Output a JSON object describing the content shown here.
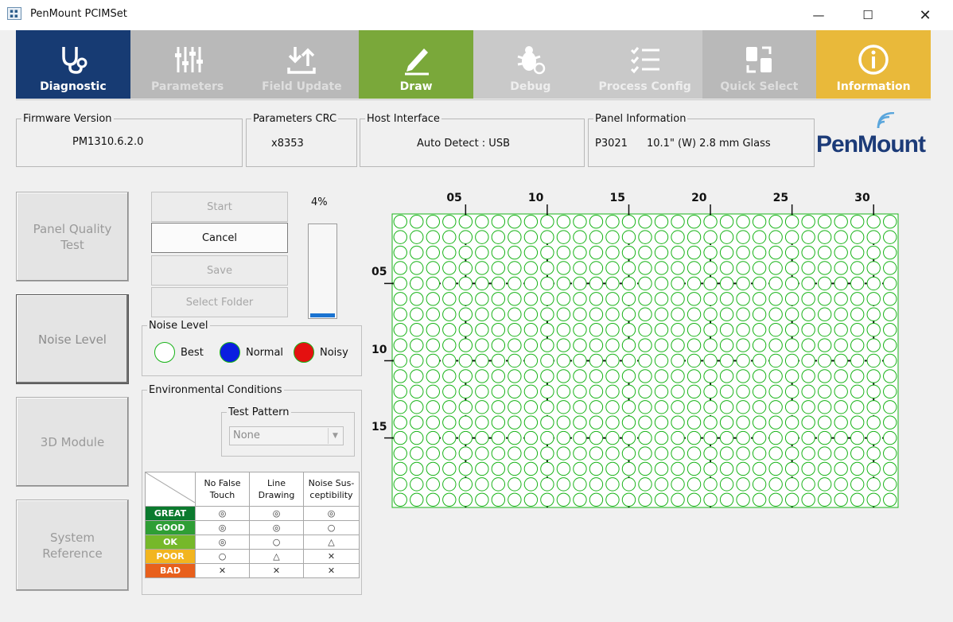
{
  "window": {
    "title": "PenMount PCIMSet",
    "minimize": "—",
    "maximize": "☐",
    "close": "✕"
  },
  "toolbar": [
    {
      "label": "Diagnostic",
      "icon": "stethoscope-icon",
      "state": "active"
    },
    {
      "label": "Parameters",
      "icon": "sliders-icon",
      "state": "disabled"
    },
    {
      "label": "Field Update",
      "icon": "upload-download-icon",
      "state": "disabled"
    },
    {
      "label": "Draw",
      "icon": "pen-icon",
      "state": "enabled"
    },
    {
      "label": "Debug",
      "icon": "bug-icon",
      "state": "disabled"
    },
    {
      "label": "Process Config",
      "icon": "checklist-icon",
      "state": "disabled"
    },
    {
      "label": "Quick Select",
      "icon": "quick-select-icon",
      "state": "disabled"
    },
    {
      "label": "Information",
      "icon": "info-icon",
      "state": "enabled"
    }
  ],
  "info": {
    "firmware": {
      "label": "Firmware Version",
      "value": "PM1310.6.2.0"
    },
    "crc": {
      "label": "Parameters CRC",
      "value": "x8353"
    },
    "host": {
      "label": "Host Interface",
      "value": "Auto Detect : USB"
    },
    "panel": {
      "label": "Panel Information",
      "id": "P3021",
      "desc": "10.1\" (W) 2.8 mm Glass"
    }
  },
  "logo": {
    "text": "PenMount"
  },
  "side_buttons": {
    "pq_line1": "Panel Quality",
    "pq_line2": "Test",
    "noise": "Noise Level",
    "module3d": "3D Module",
    "sr_line1": "System",
    "sr_line2": "Reference"
  },
  "actions": {
    "start": "Start",
    "cancel": "Cancel",
    "save": "Save",
    "select_folder": "Select Folder"
  },
  "progress": {
    "percent_label": "4%",
    "value": 0.04
  },
  "noise_level": {
    "title": "Noise Level",
    "best": "Best",
    "normal": "Normal",
    "noisy": "Noisy"
  },
  "env": {
    "title": "Environmental Conditions",
    "pattern_title": "Test Pattern",
    "pattern_value": "None",
    "columns": {
      "c1a": "No False",
      "c1b": "Touch",
      "c2a": "Line",
      "c2b": "Drawing",
      "c3a": "Noise Sus-",
      "c3b": "ceptibility"
    },
    "rows": [
      {
        "level": "GREAT",
        "s1": "◎",
        "s2": "◎",
        "s3": "◎"
      },
      {
        "level": "GOOD",
        "s1": "◎",
        "s2": "◎",
        "s3": "○"
      },
      {
        "level": "OK",
        "s1": "◎",
        "s2": "○",
        "s3": "△"
      },
      {
        "level": "POOR",
        "s1": "○",
        "s2": "△",
        "s3": "✕"
      },
      {
        "level": "BAD",
        "s1": "✕",
        "s2": "✕",
        "s3": "✕"
      }
    ]
  },
  "grid": {
    "columns": 31,
    "rows": 19,
    "x_ticks": [
      "05",
      "10",
      "15",
      "20",
      "25",
      "30"
    ],
    "y_ticks": [
      "05",
      "10",
      "15"
    ],
    "node_color": "#18b318"
  }
}
